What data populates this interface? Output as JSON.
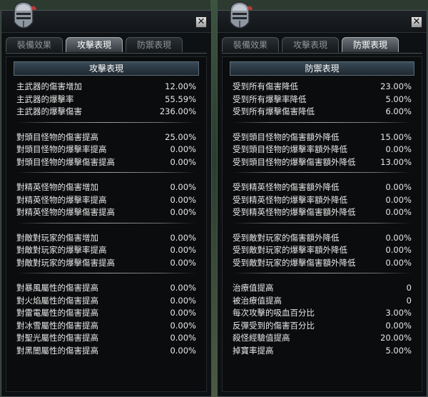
{
  "tabs": [
    "裝備效果",
    "攻擊表現",
    "防禦表現"
  ],
  "close_label": "✕",
  "left": {
    "active_tab": 1,
    "header": "攻擊表現",
    "groups": [
      [
        {
          "label": "主武器的傷害增加",
          "value": "12.00%"
        },
        {
          "label": "主武器的爆擊率",
          "value": "55.59%"
        },
        {
          "label": "主武器的爆擊傷害",
          "value": "236.00%"
        }
      ],
      [
        {
          "label": "對頭目怪物的傷害提高",
          "value": "25.00%"
        },
        {
          "label": "對頭目怪物的爆擊率提高",
          "value": "0.00%"
        },
        {
          "label": "對頭目怪物的爆擊傷害提高",
          "value": "0.00%"
        }
      ],
      [
        {
          "label": "對精英怪物的傷害增加",
          "value": "0.00%"
        },
        {
          "label": "對精英怪物的爆擊率提高",
          "value": "0.00%"
        },
        {
          "label": "對精英怪物的爆擊傷害提高",
          "value": "0.00%"
        }
      ],
      [
        {
          "label": "對敵對玩家的傷害增加",
          "value": "0.00%"
        },
        {
          "label": "對敵對玩家的爆擊率提高",
          "value": "0.00%"
        },
        {
          "label": "對敵對玩家的爆擊傷害提高",
          "value": "0.00%"
        }
      ],
      [
        {
          "label": "對暴風屬性的傷害提高",
          "value": "0.00%"
        },
        {
          "label": "對火焰屬性的傷害提高",
          "value": "0.00%"
        },
        {
          "label": "對雷電屬性的傷害提高",
          "value": "0.00%"
        },
        {
          "label": "對冰雪屬性的傷害提高",
          "value": "0.00%"
        },
        {
          "label": "對聖光屬性的傷害提高",
          "value": "0.00%"
        },
        {
          "label": "對黑闇屬性的傷害提高",
          "value": "0.00%"
        }
      ]
    ]
  },
  "right": {
    "active_tab": 2,
    "header": "防禦表現",
    "groups": [
      [
        {
          "label": "受到所有傷害降低",
          "value": "23.00%"
        },
        {
          "label": "受到所有爆擊率降低",
          "value": "5.00%"
        },
        {
          "label": "受到所有爆擊傷害降低",
          "value": "6.00%"
        }
      ],
      [
        {
          "label": "受到頭目怪物的傷害額外降低",
          "value": "15.00%"
        },
        {
          "label": "受到頭目怪物的爆擊率額外降低",
          "value": "0.00%"
        },
        {
          "label": "受到頭目怪物的爆擊傷害額外降低",
          "value": "13.00%"
        }
      ],
      [
        {
          "label": "受到精英怪物的傷害額外降低",
          "value": "0.00%"
        },
        {
          "label": "受到精英怪物的爆擊率額外降低",
          "value": "0.00%"
        },
        {
          "label": "受到精英怪物的爆擊傷害額外降低",
          "value": "0.00%"
        }
      ],
      [
        {
          "label": "受到敵對玩家的傷害額外降低",
          "value": "0.00%"
        },
        {
          "label": "受到敵對玩家的爆擊率額外降低",
          "value": "0.00%"
        },
        {
          "label": "受到敵對玩家的爆擊傷害額外降低",
          "value": "0.00%"
        }
      ],
      [
        {
          "label": "治療值提高",
          "value": "0"
        },
        {
          "label": "被治療值提高",
          "value": "0"
        },
        {
          "label": "每次攻擊的吸血百分比",
          "value": "3.00%"
        },
        {
          "label": "反彈受到的傷害百分比",
          "value": "0.00%"
        },
        {
          "label": "殺怪經驗值提高",
          "value": "20.00%"
        },
        {
          "label": "掉寶率提高",
          "value": "5.00%"
        }
      ]
    ]
  }
}
